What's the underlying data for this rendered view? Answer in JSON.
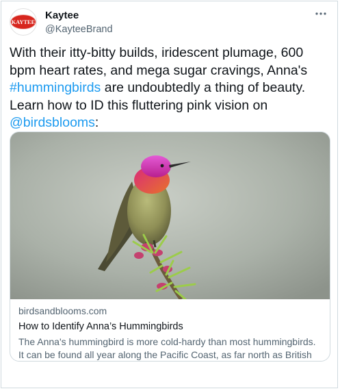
{
  "author": {
    "display_name": "Kaytee",
    "handle": "@KayteeBrand",
    "logo_text": "KAYTEE"
  },
  "tweet": {
    "segment_1": "With their itty-bitty builds, iridescent plumage, 600 bpm heart rates, and mega sugar cravings, Anna's ",
    "hashtag": "#hummingbirds",
    "segment_2": " are undoubtedly a thing of beauty. Learn how to ID this fluttering pink vision on ",
    "mention": "@birdsblooms",
    "segment_3": ":"
  },
  "card": {
    "domain": "birdsandblooms.com",
    "title": "How to Identify Anna’s Hummingbirds",
    "description": "The Anna's hummingbird is more cold-hardy than most hummingbirds. It can be found all year along the Pacific Coast, as far north as British Columbia."
  },
  "icons": {
    "more": "more-horizontal-icon"
  },
  "colors": {
    "link": "#1d9bf0",
    "secondary_text": "#536471",
    "brand_red": "#d7261e"
  }
}
